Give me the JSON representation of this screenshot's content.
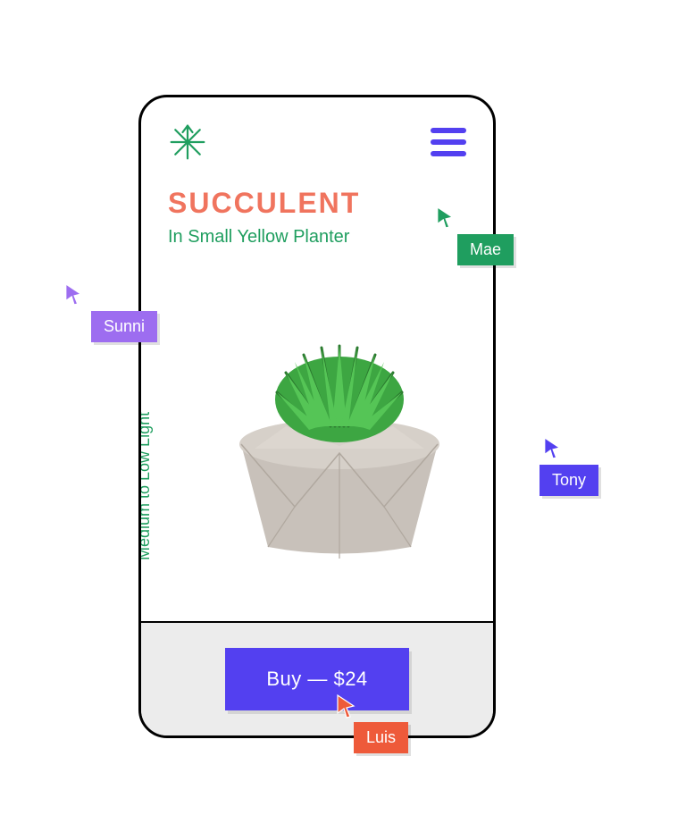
{
  "product": {
    "title": "SUCCULENT",
    "subtitle": "In Small Yellow Planter",
    "light": "Medium to Low Light"
  },
  "buy": {
    "label": "Buy — $24"
  },
  "collaborators": {
    "sunni": "Sunni",
    "mae": "Mae",
    "tony": "Tony",
    "luis": "Luis"
  },
  "colors": {
    "accent_purple": "#5340f0",
    "green": "#1f9e5f",
    "coral": "#f0745e",
    "lilac": "#9d6df0",
    "orange": "#ee5a3a"
  }
}
